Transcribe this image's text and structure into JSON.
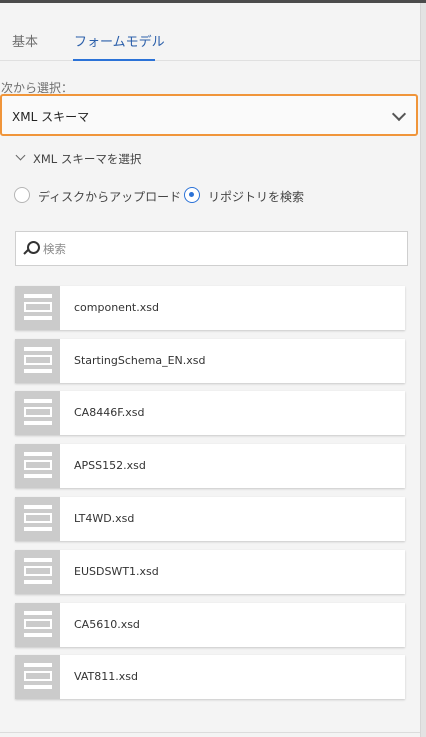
{
  "tabs": [
    {
      "label": "基本",
      "active": false
    },
    {
      "label": "フォームモデル",
      "active": true
    }
  ],
  "select_from": {
    "label": "次から選択：",
    "value": "XML スキーマ"
  },
  "section": {
    "label": "XML スキーマを選択",
    "expanded": true
  },
  "source_options": [
    {
      "label": "ディスクからアップロード",
      "selected": false
    },
    {
      "label": "リポジトリを検索",
      "selected": true
    }
  ],
  "search": {
    "placeholder": "検索",
    "value": ""
  },
  "files": [
    {
      "name": "component.xsd",
      "icon": "schema-doc-icon"
    },
    {
      "name": "StartingSchema_EN.xsd",
      "icon": "schema-doc-icon"
    },
    {
      "name": "CA8446F.xsd",
      "icon": "schema-doc-icon"
    },
    {
      "name": "APSS152.xsd",
      "icon": "schema-doc-icon"
    },
    {
      "name": "LT4WD.xsd",
      "icon": "schema-doc-icon"
    },
    {
      "name": "EUSDSWT1.xsd",
      "icon": "schema-doc-icon"
    },
    {
      "name": "CA5610.xsd",
      "icon": "schema-doc-icon"
    },
    {
      "name": "VAT811.xsd",
      "icon": "schema-doc-icon"
    }
  ],
  "colors": {
    "accent": "#2b72d7",
    "focus_border": "#f0953a",
    "thumb_bg": "#cbcbcb"
  }
}
